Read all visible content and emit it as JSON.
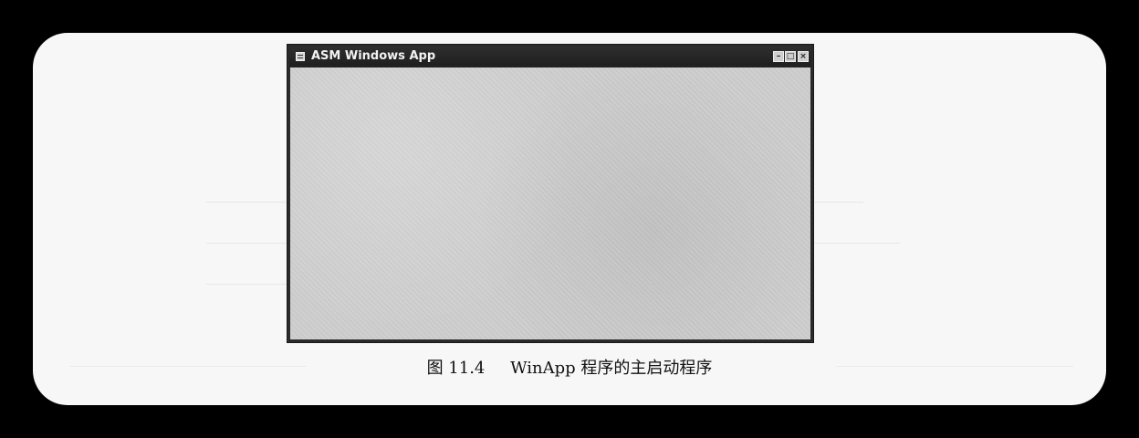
{
  "window": {
    "title": "ASM Windows App",
    "controls": {
      "minimize_icon": "minimize-icon",
      "maximize_icon": "maximize-icon",
      "close_icon": "close-icon"
    }
  },
  "caption": {
    "number": "图 11.4",
    "text": "WinApp 程序的主启动程序"
  },
  "colors": {
    "background": "#000000",
    "page": "#f7f7f7",
    "titlebar": "#252525",
    "client_area": "#cfcfcf"
  }
}
